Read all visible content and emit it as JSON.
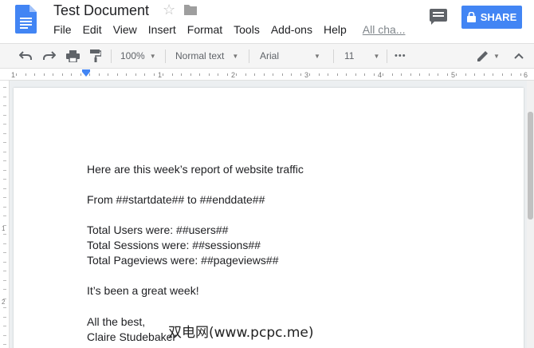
{
  "header": {
    "title": "Test Document",
    "star_icon": "☆",
    "menu": [
      "File",
      "Edit",
      "View",
      "Insert",
      "Format",
      "Tools",
      "Add-ons",
      "Help"
    ],
    "changes_link": "All cha...",
    "share_label": "SHARE"
  },
  "toolbar": {
    "zoom": "100%",
    "style": "Normal text",
    "font": "Arial",
    "size": "11",
    "more": "•••"
  },
  "ruler": {
    "marks": [
      "1",
      "1",
      "2",
      "3",
      "4",
      "5",
      "6"
    ]
  },
  "vruler": {
    "marks": [
      "1",
      "2"
    ]
  },
  "document": {
    "lines": [
      "Here are this week’s report of website traffic",
      "From ##startdate## to ##enddate##",
      "Total Users were: ##users##",
      "Total Sessions were: ##sessions##",
      "Total Pageviews were: ##pageviews##",
      "It’s been a great week!",
      "All the best,",
      "Claire Studebaker"
    ]
  },
  "watermark": "双电网(www.pcpc.me)",
  "colors": {
    "accent": "#4285f4",
    "toolbar_bg": "#f5f5f5",
    "canvas_bg": "#eceff1"
  }
}
